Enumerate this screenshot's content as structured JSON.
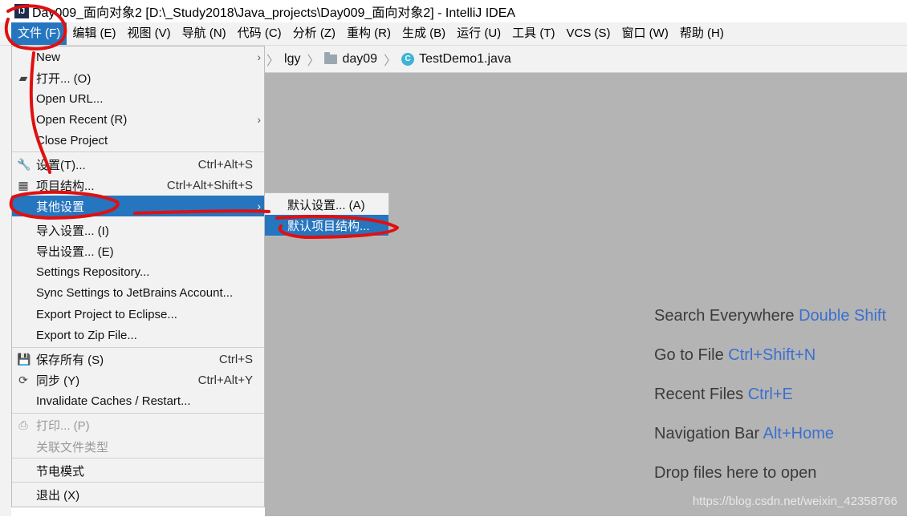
{
  "window": {
    "title": "Day009_面向对象2 [D:\\_Study2018\\Java_projects\\Day009_面向对象2] - IntelliJ IDEA"
  },
  "menubar": {
    "items": [
      "文件 (F)",
      "编辑 (E)",
      "视图 (V)",
      "导航 (N)",
      "代码 (C)",
      "分析 (Z)",
      "重构 (R)",
      "生成 (B)",
      "运行 (U)",
      "工具 (T)",
      "VCS (S)",
      "窗口 (W)",
      "帮助 (H)"
    ]
  },
  "breadcrumb": {
    "items": [
      "lgy",
      "day09",
      "TestDemo1.java"
    ]
  },
  "file_menu": {
    "items": [
      {
        "label": "New",
        "shortcut": "",
        "icon": "",
        "submenu": true
      },
      {
        "label": "打开... (O)",
        "shortcut": "",
        "icon": "folder-open-icon"
      },
      {
        "label": "Open URL...",
        "shortcut": ""
      },
      {
        "label": "Open Recent (R)",
        "shortcut": "",
        "submenu": true
      },
      {
        "label": "Close Project",
        "shortcut": ""
      },
      {
        "label": "设置(T)...",
        "shortcut": "Ctrl+Alt+S",
        "icon": "wrench-icon"
      },
      {
        "label": "项目结构...",
        "shortcut": "Ctrl+Alt+Shift+S",
        "icon": "project-structure-icon"
      },
      {
        "label": "其他设置",
        "shortcut": "",
        "submenu": true,
        "selected": true
      },
      {
        "label": "导入设置... (I)",
        "shortcut": ""
      },
      {
        "label": "导出设置... (E)",
        "shortcut": ""
      },
      {
        "label": "Settings Repository...",
        "shortcut": ""
      },
      {
        "label": "Sync Settings to JetBrains Account...",
        "shortcut": ""
      },
      {
        "label": "Export Project to Eclipse...",
        "shortcut": ""
      },
      {
        "label": "Export to Zip File...",
        "shortcut": ""
      },
      {
        "label": "保存所有 (S)",
        "shortcut": "Ctrl+S",
        "icon": "save-icon"
      },
      {
        "label": "同步 (Y)",
        "shortcut": "Ctrl+Alt+Y",
        "icon": "sync-icon"
      },
      {
        "label": "Invalidate Caches / Restart...",
        "shortcut": ""
      },
      {
        "label": "打印... (P)",
        "shortcut": "",
        "icon": "print-icon",
        "disabled": true
      },
      {
        "label": "关联文件类型",
        "shortcut": "",
        "disabled": true
      },
      {
        "label": "节电模式",
        "shortcut": ""
      },
      {
        "label": "退出 (X)",
        "shortcut": ""
      }
    ]
  },
  "submenu": {
    "items": [
      "默认设置... (A)",
      "默认项目结构..."
    ]
  },
  "editor_hints": [
    {
      "text": "Search Everywhere",
      "key": "Double Shift"
    },
    {
      "text": "Go to File",
      "key": "Ctrl+Shift+N"
    },
    {
      "text": "Recent Files",
      "key": "Ctrl+E"
    },
    {
      "text": "Navigation Bar",
      "key": "Alt+Home"
    },
    {
      "text": "Drop files here to open",
      "key": ""
    }
  ],
  "watermark": "https://blog.csdn.net/weixin_42358766",
  "colors": {
    "selection": "#2675bf",
    "annotation": "#e01010",
    "editor_bg": "#b4b4b4",
    "hint_key": "#3c6fcf"
  }
}
